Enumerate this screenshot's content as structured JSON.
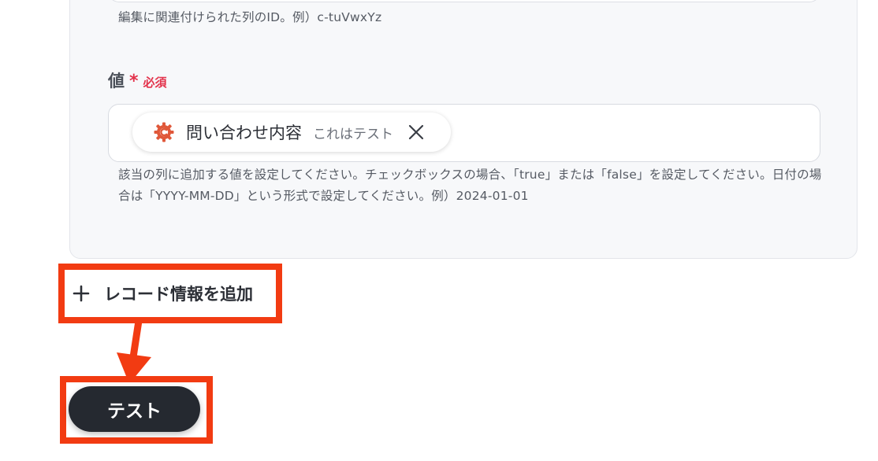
{
  "column_field": {
    "hint": "編集に関連付けられた列のID。例）c-tuVwxYz"
  },
  "value_field": {
    "label": "値",
    "required_star": "*",
    "required_text": "必須",
    "chip": {
      "icon": "gear-c-icon",
      "label": "問い合わせ内容",
      "value": "これはテスト"
    },
    "hint": "該当の列に追加する値を設定してください。チェックボックスの場合、「true」または「false」を設定してください。日付の場合は「YYYY-MM-DD」という形式で設定してください。例）2024-01-01"
  },
  "actions": {
    "add_record_label": "レコード情報を追加",
    "test_label": "テスト"
  },
  "colors": {
    "highlight": "#f23b12",
    "required": "#e3324b",
    "chip_icon": "#e0583a",
    "test_button": "#252930"
  }
}
